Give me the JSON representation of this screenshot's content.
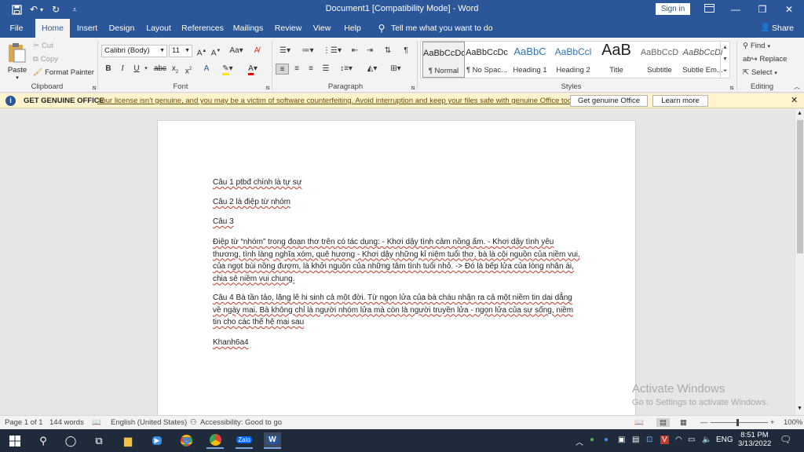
{
  "title": {
    "doc": "Document1 [Compatibility Mode] - Word",
    "sign_in": "Sign in"
  },
  "tabs": [
    {
      "label": "File"
    },
    {
      "label": "Home"
    },
    {
      "label": "Insert"
    },
    {
      "label": "Design"
    },
    {
      "label": "Layout"
    },
    {
      "label": "References"
    },
    {
      "label": "Mailings"
    },
    {
      "label": "Review"
    },
    {
      "label": "View"
    },
    {
      "label": "Help"
    }
  ],
  "tell_me": "Tell me what you want to do",
  "share": "Share",
  "ribbon": {
    "clipboard": {
      "paste": "Paste",
      "cut": "Cut",
      "copy": "Copy",
      "format_painter": "Format Painter",
      "label": "Clipboard"
    },
    "font": {
      "name": "Calibri (Body)",
      "size": "11",
      "label": "Font"
    },
    "paragraph": {
      "label": "Paragraph"
    },
    "styles": {
      "items": [
        {
          "preview": "AaBbCcDc",
          "label": "¶ Normal"
        },
        {
          "preview": "AaBbCcDc",
          "label": "¶ No Spac..."
        },
        {
          "preview": "AaBbC",
          "label": "Heading 1"
        },
        {
          "preview": "AaBbCcl",
          "label": "Heading 2"
        },
        {
          "preview": "AaB",
          "label": "Title"
        },
        {
          "preview": "AaBbCcD",
          "label": "Subtitle"
        },
        {
          "preview": "AaBbCcDi",
          "label": "Subtle Em..."
        }
      ],
      "label": "Styles"
    },
    "editing": {
      "find": "Find",
      "replace": "Replace",
      "select": "Select",
      "label": "Editing"
    }
  },
  "infobar": {
    "title": "GET GENUINE OFFICE",
    "message": "Your license isn't genuine, and you may be a victim of software counterfeiting. Avoid interruption and keep your files safe with genuine Office today.",
    "btn_genuine": "Get genuine Office",
    "btn_learn": "Learn more"
  },
  "document": {
    "p1": "Câu 1  ptbđ chính là tự sự",
    "p2": "Câu 2 là  điệp từ nhóm",
    "p3": "Câu 3",
    "p4": "Điệp từ “nhóm” trong đoạn thơ trên có tác dụng: - Khơi dậy tình cảm nồng ấm. - Khơi dậy tình yêu thương, tình làng nghĩa xóm, quê hương - Khơi dậy những kỉ niệm tuổi thơ, bà là cội nguồn của niềm vui, của ngọt bùi nồng đượm, là khởi nguồn của những tâm tình tuổi nhỏ. -> Đó là bếp lửa của lòng nhân ái, chia sẻ niềm vui chung.",
    "p5": "Câu 4 Bà tần tảo, lặng lẽ hi sinh cả một đời. Từ ngọn lửa của bà cháu nhận ra cả một niềm tin dai dẳng về ngày mai. Bà không chỉ là người nhóm lửa mà còn là người truyền lửa - ngọn lửa của sự sống, niềm tin cho các thế hệ mai sau",
    "p6": "Khanh6a4"
  },
  "watermark": {
    "line1": "Activate Windows",
    "line2": "Go to Settings to activate Windows."
  },
  "status": {
    "page": "Page 1 of 1",
    "words": "144 words",
    "language": "English (United States)",
    "accessibility": "Accessibility: Good to go",
    "zoom": "100%"
  },
  "taskbar": {
    "time": "8:51 PM",
    "date": "3/13/2022",
    "lang": "ENG"
  }
}
